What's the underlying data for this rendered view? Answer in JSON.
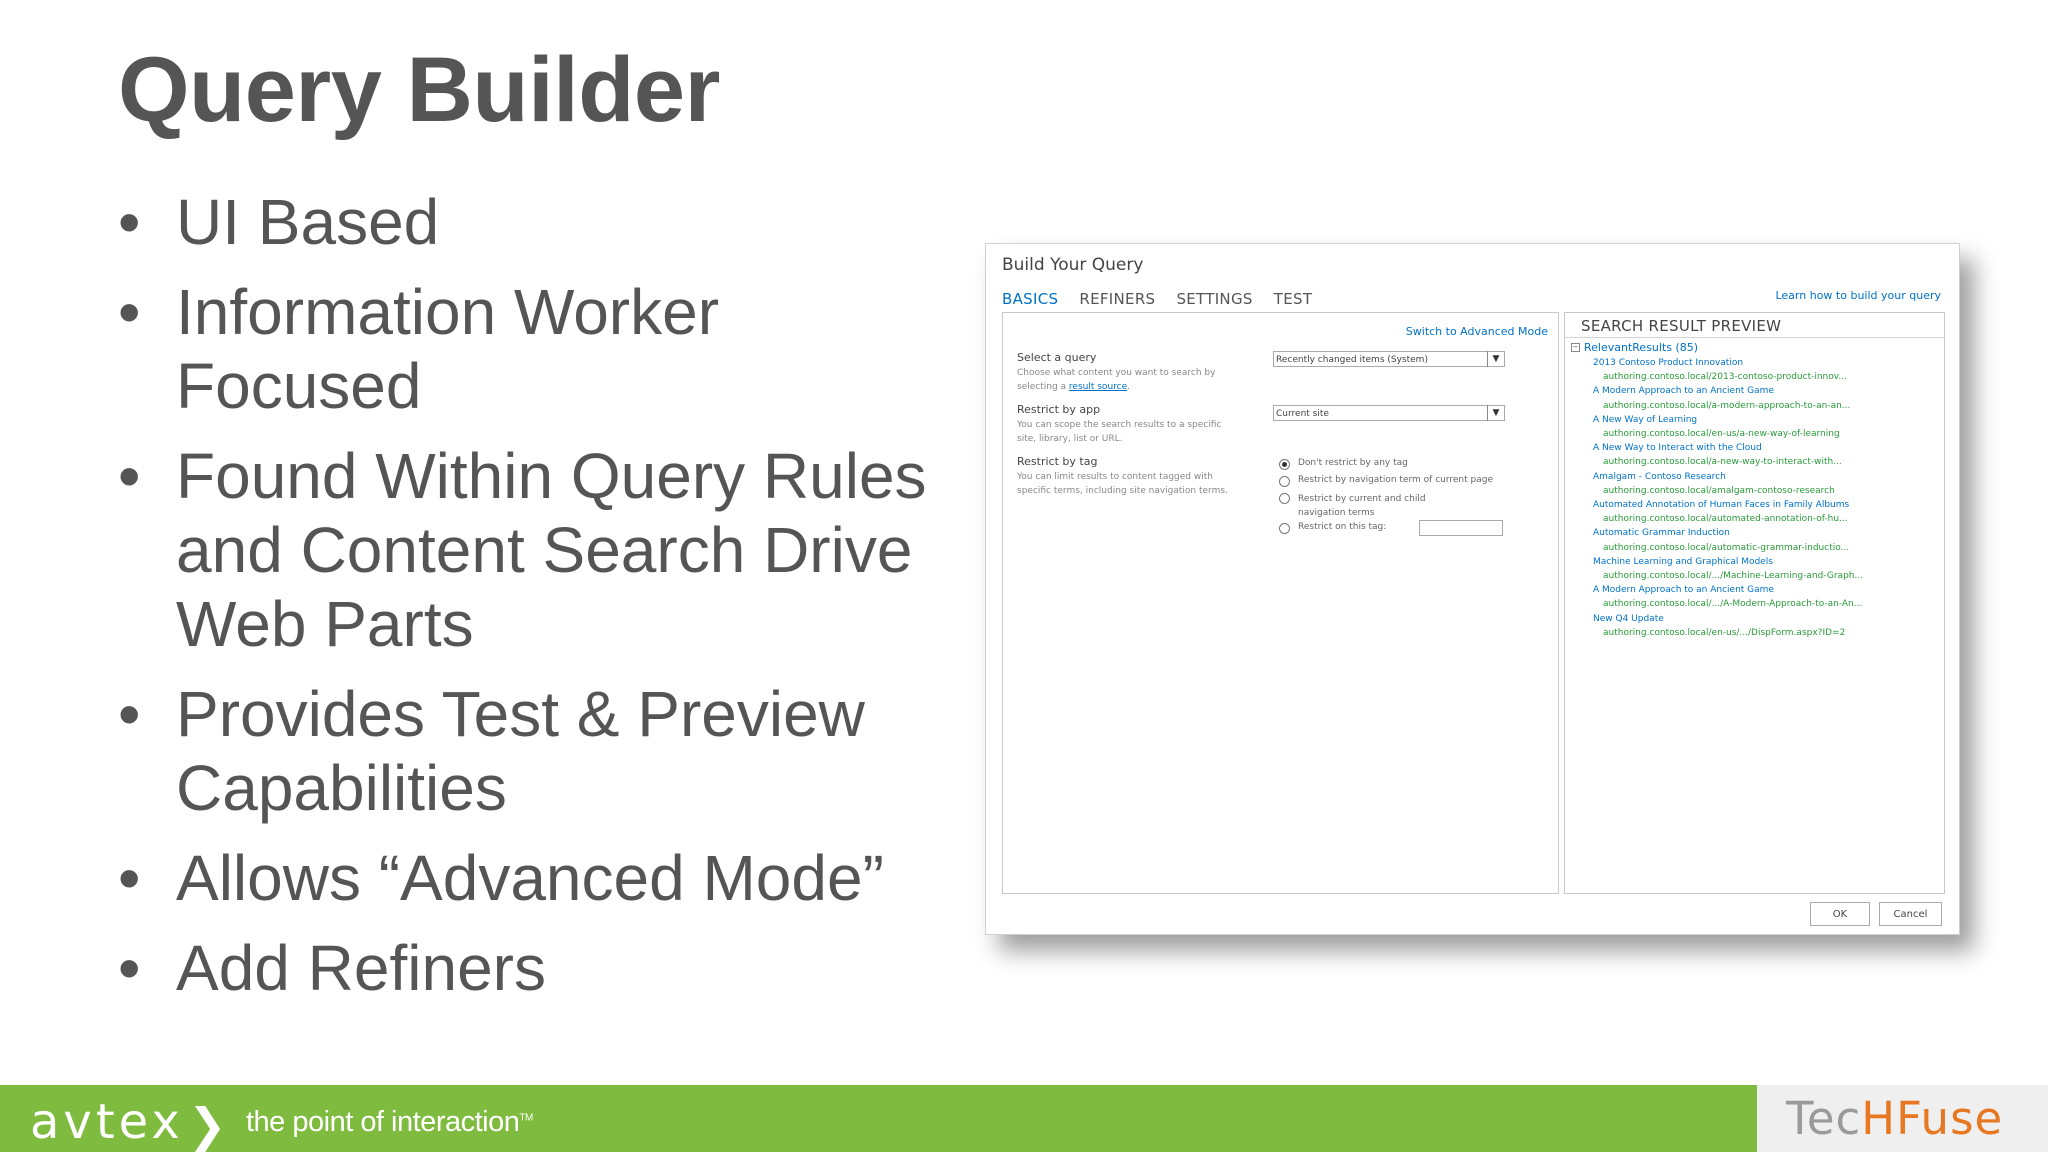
{
  "slide": {
    "title": "Query Builder",
    "bullets": [
      "UI Based",
      "Information Worker Focused",
      "Found Within Query Rules and Content Search Drive Web Parts",
      "Provides Test & Preview Capabilities",
      "Allows “Advanced Mode”",
      "Add Refiners"
    ]
  },
  "dialog": {
    "title": "Build Your Query",
    "tabs": [
      "BASICS",
      "REFINERS",
      "SETTINGS",
      "TEST"
    ],
    "learn_link": "Learn how to build your query",
    "advanced_link": "Switch to Advanced Mode",
    "select_query": {
      "label": "Select a query",
      "desc": "Choose what content you want to search by selecting a",
      "desc_link": "result source",
      "desc_end": ".",
      "value": "Recently changed items (System)"
    },
    "restrict_app": {
      "label": "Restrict by app",
      "desc": "You can scope the search results to a specific site, library, list or URL.",
      "value": "Current site"
    },
    "restrict_tag": {
      "label": "Restrict by tag",
      "desc": "You can limit results to content tagged with specific terms, including site navigation terms.",
      "options": [
        "Don't restrict by any tag",
        "Restrict by navigation term of current page",
        "Restrict by current and child navigation terms",
        "Restrict on this tag:"
      ]
    },
    "preview": {
      "heading": "SEARCH RESULT PREVIEW",
      "group": "RelevantResults (85)",
      "results": [
        {
          "title": "2013 Contoso Product Innovation",
          "url": "authoring.contoso.local/2013-contoso-product-innov..."
        },
        {
          "title": "A Modern Approach to an Ancient Game",
          "url": "authoring.contoso.local/a-modern-approach-to-an-an..."
        },
        {
          "title": "A New Way of Learning",
          "url": "authoring.contoso.local/en-us/a-new-way-of-learning"
        },
        {
          "title": "A New Way to Interact with the Cloud",
          "url": "authoring.contoso.local/a-new-way-to-interact-with..."
        },
        {
          "title": "Amalgam - Contoso Research",
          "url": "authoring.contoso.local/amalgam-contoso-research"
        },
        {
          "title": "Automated Annotation of Human Faces in Family Albums",
          "url": "authoring.contoso.local/automated-annotation-of-hu..."
        },
        {
          "title": "Automatic Grammar Induction",
          "url": "authoring.contoso.local/automatic-grammar-inductio..."
        },
        {
          "title": "Machine Learning and Graphical Models",
          "url": "authoring.contoso.local/.../Machine-Learning-and-Graph..."
        },
        {
          "title": "A Modern Approach to an Ancient Game",
          "url": "authoring.contoso.local/.../A-Modern-Approach-to-an-An..."
        },
        {
          "title": "New Q4 Update",
          "url": "authoring.contoso.local/en-us/.../DispForm.aspx?ID=2"
        }
      ]
    },
    "buttons": {
      "ok": "OK",
      "cancel": "Cancel"
    }
  },
  "footer": {
    "brand": "avtex",
    "tagline": "the point of interaction",
    "tm": "TM",
    "partner_part1": "Tec",
    "partner_part2": "HFuse"
  },
  "colors": {
    "footer_green": "#7fbb3f",
    "link_blue": "#0072c6",
    "url_green": "#2a9a3a",
    "text_gray": "#555555"
  }
}
